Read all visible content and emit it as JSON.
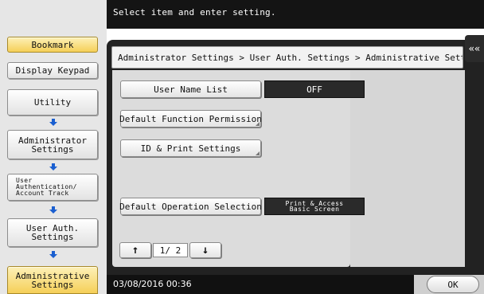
{
  "header": {
    "message": "Select item and enter setting."
  },
  "left_panel": {
    "bookmark_label": "Bookmark",
    "display_keypad_label": "Display Keypad",
    "nav": [
      {
        "label": "Utility"
      },
      {
        "label": "Administrator\nSettings"
      },
      {
        "label": "User\nAuthentication/\nAccount Track"
      },
      {
        "label": "User Auth.\nSettings"
      },
      {
        "label": "Administrative\nSettings"
      }
    ]
  },
  "breadcrumb": "Administrator Settings > User Auth. Settings > Administrative Settings",
  "collapse_icon": "««",
  "settings": [
    {
      "label": "User Name List",
      "value": "OFF"
    },
    {
      "label": "Default Function Permission"
    },
    {
      "label": "ID & Print Settings"
    },
    {
      "label": "Default Operation Selection",
      "value_line1": "Print & Access",
      "value_line2": "Basic Screen"
    }
  ],
  "pager": {
    "up_icon": "↑",
    "down_icon": "↓",
    "indicator": "1/ 2"
  },
  "footer": {
    "datetime": "03/08/2016  00:36",
    "ok_label": "OK"
  },
  "colors": {
    "accent_yellow": "#f5cf58",
    "dark": "#141414",
    "panel": "#dcdcdc"
  }
}
